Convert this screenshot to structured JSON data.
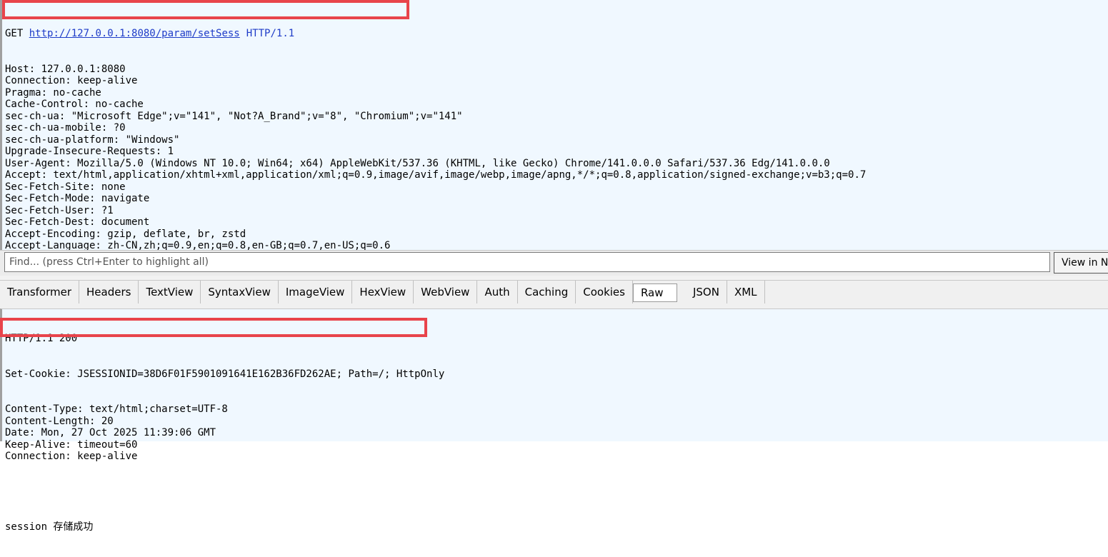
{
  "request": {
    "method": "GET",
    "url": "http://127.0.0.1:8080/param/setSess",
    "protocol": "HTTP/1.1",
    "headers": [
      "Host: 127.0.0.1:8080",
      "Connection: keep-alive",
      "Pragma: no-cache",
      "Cache-Control: no-cache",
      "sec-ch-ua: \"Microsoft Edge\";v=\"141\", \"Not?A_Brand\";v=\"8\", \"Chromium\";v=\"141\"",
      "sec-ch-ua-mobile: ?0",
      "sec-ch-ua-platform: \"Windows\"",
      "Upgrade-Insecure-Requests: 1",
      "User-Agent: Mozilla/5.0 (Windows NT 10.0; Win64; x64) AppleWebKit/537.36 (KHTML, like Gecko) Chrome/141.0.0.0 Safari/537.36 Edg/141.0.0.0",
      "Accept: text/html,application/xhtml+xml,application/xml;q=0.9,image/avif,image/webp,image/apng,*/*;q=0.8,application/signed-exchange;v=b3;q=0.7",
      "Sec-Fetch-Site: none",
      "Sec-Fetch-Mode: navigate",
      "Sec-Fetch-User: ?1",
      "Sec-Fetch-Dest: document",
      "Accept-Encoding: gzip, deflate, br, zstd",
      "Accept-Language: zh-CN,zh;q=0.9,en;q=0.8,en-GB;q=0.7,en-US;q=0.6"
    ]
  },
  "find_bar": {
    "placeholder": "Find... (press Ctrl+Enter to highlight all)",
    "view_button": "View in Notepad"
  },
  "response_tabs": [
    "Transformer",
    "Headers",
    "TextView",
    "SyntaxView",
    "ImageView",
    "HexView",
    "WebView",
    "Auth",
    "Caching",
    "Cookies",
    "Raw",
    "JSON",
    "XML"
  ],
  "active_tab": "Raw",
  "response": {
    "status_line": "HTTP/1.1 200",
    "set_cookie": "Set-Cookie: JSESSIONID=38D6F01F5901091641E162B36FD262AE;",
    "set_cookie_rest": " Path=/; HttpOnly",
    "headers": [
      "Content-Type: text/html;charset=UTF-8",
      "Content-Length: 20",
      "Date: Mon, 27 Oct 2025 11:39:06 GMT",
      "Keep-Alive: timeout=60",
      "Connection: keep-alive"
    ],
    "body": "session 存储成功"
  },
  "colors": {
    "pane_background": "#f0f8ff",
    "highlight_box": "#e8444b",
    "link": "#1e3cc8"
  }
}
